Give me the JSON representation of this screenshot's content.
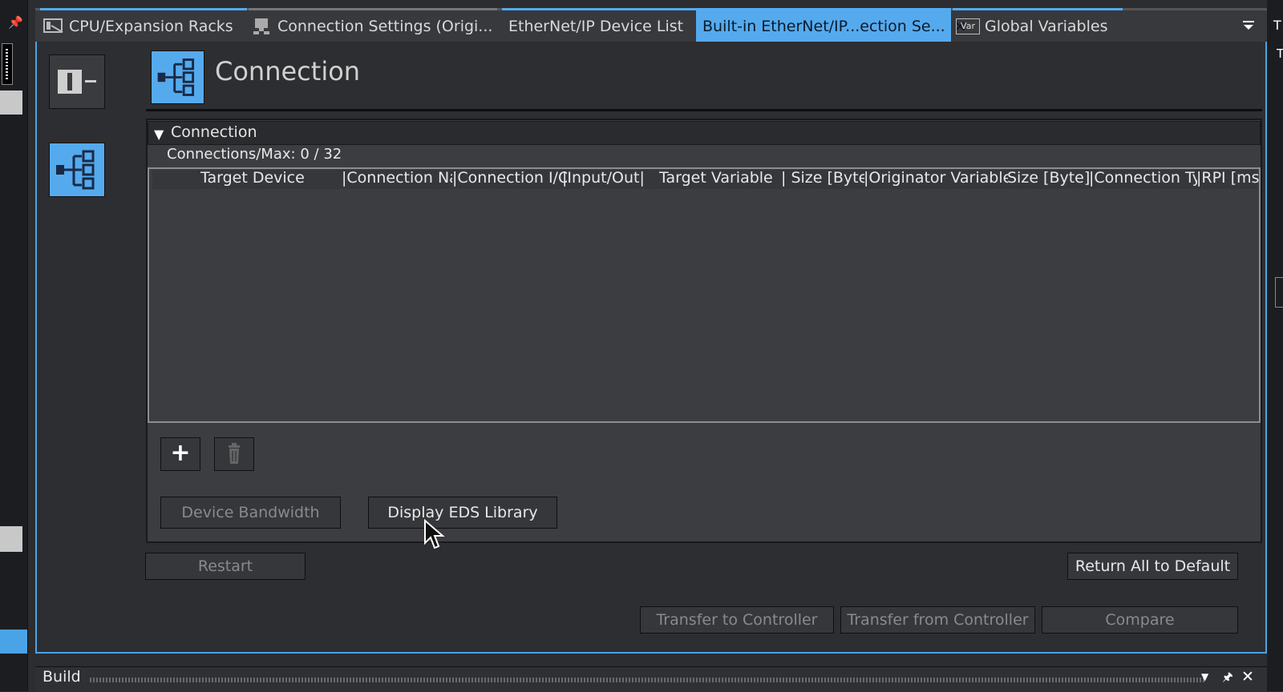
{
  "tabs": [
    {
      "label": "CPU/Expansion Racks",
      "icon": "rack-icon"
    },
    {
      "label": "Connection Settings (Origi...",
      "icon": "connection-settings-icon"
    },
    {
      "label": "EtherNet/IP Device List",
      "icon": ""
    },
    {
      "label": "Built-in EtherNet/IP...ection Se...",
      "icon": "",
      "active": true
    },
    {
      "label": "Global Variables",
      "icon": "var-icon"
    }
  ],
  "tab_close_glyph": "✕",
  "global_vars_icon_text": "Var",
  "page": {
    "title": "Connection"
  },
  "section": {
    "title": "Connection",
    "connections_label": "Connections/Max:",
    "connections_value": "0",
    "connections_sep": "/",
    "connections_max": "32"
  },
  "table": {
    "columns": [
      "Target Device",
      "|Connection Na",
      "|Connection I/O",
      "|Input/Out|",
      "Target Variable",
      "| Size [Byte]",
      "|Originator Variable|",
      " Size [Byte]",
      "|Connection Ty",
      "|RPI [ms]"
    ],
    "rows": []
  },
  "buttons": {
    "device_bandwidth": "Device Bandwidth",
    "display_eds": "Display EDS Library",
    "restart": "Restart",
    "return_default": "Return All to Default",
    "transfer_to": "Transfer to Controller",
    "transfer_from": "Transfer from Controller",
    "compare": "Compare"
  },
  "build_panel": {
    "title": "Build"
  },
  "right_strip": {
    "top_label": "T",
    "second_label": "T"
  },
  "colors": {
    "accent": "#55aaee",
    "background": "#2d2e32",
    "panel": "#3c3d41"
  }
}
